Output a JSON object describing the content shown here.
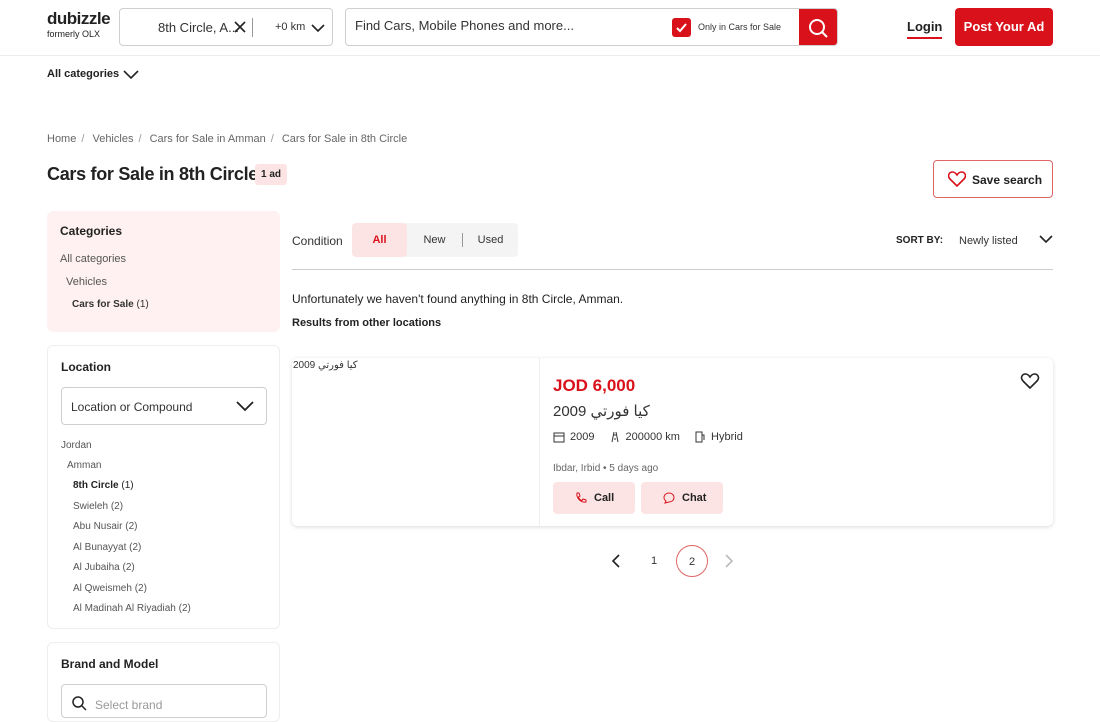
{
  "header": {
    "logo_top": "dubizzle",
    "logo_bottom": "formerly OLX",
    "location_value": "8th Circle, A...",
    "radius": "+0 km",
    "search_placeholder": "Find Cars, Mobile Phones and more...",
    "only_in_label": "Only in Cars for Sale",
    "login": "Login",
    "post_ad": "Post Your Ad"
  },
  "all_categories": "All categories",
  "breadcrumbs": [
    "Home",
    "Vehicles",
    "Cars for Sale in Amman",
    "Cars for Sale in 8th Circle"
  ],
  "page": {
    "title": "Cars for Sale in 8th Circle",
    "count_badge": "1 ad",
    "save_search": "Save search"
  },
  "categories": {
    "heading": "Categories",
    "all": "All categories",
    "vehicles": "Vehicles",
    "current": "Cars for Sale",
    "current_count": "(1)"
  },
  "location": {
    "heading": "Location",
    "select_placeholder": "Location or Compound",
    "country": "Jordan",
    "city": "Amman",
    "areas": [
      {
        "name": "8th Circle",
        "count": "(1)",
        "bold": true
      },
      {
        "name": "Swieleh",
        "count": "(2)"
      },
      {
        "name": "Abu Nusair",
        "count": "(2)"
      },
      {
        "name": "Al Bunayyat",
        "count": "(2)"
      },
      {
        "name": "Al Jubaiha",
        "count": "(2)"
      },
      {
        "name": "Al Qweismeh",
        "count": "(2)"
      },
      {
        "name": "Al Madinah Al Riyadiah",
        "count": "(2)"
      }
    ]
  },
  "brand": {
    "heading": "Brand and Model",
    "placeholder": "Select brand"
  },
  "filters": {
    "condition_label": "Condition",
    "options": [
      "All",
      "New",
      "Used"
    ],
    "selected": "All",
    "sort_label": "SORT BY:",
    "sort_value": "Newly listed"
  },
  "results": {
    "no_results": "Unfortunately we haven't found anything in 8th Circle, Amman.",
    "other_locations": "Results from other locations"
  },
  "listing": {
    "image_alt": "كيا فورتي 2009",
    "price": "JOD 6,000",
    "title": "كيا فورتي 2009",
    "year": "2009",
    "mileage": "200000 km",
    "fuel": "Hybrid",
    "location_time": "Ibdar, Irbid • 5 days ago",
    "call": "Call",
    "chat": "Chat"
  },
  "pagination": {
    "pages": [
      "1",
      "2"
    ],
    "current": "2"
  },
  "colors": {
    "accent": "#d9111b",
    "accent_light": "#fde4e4"
  }
}
